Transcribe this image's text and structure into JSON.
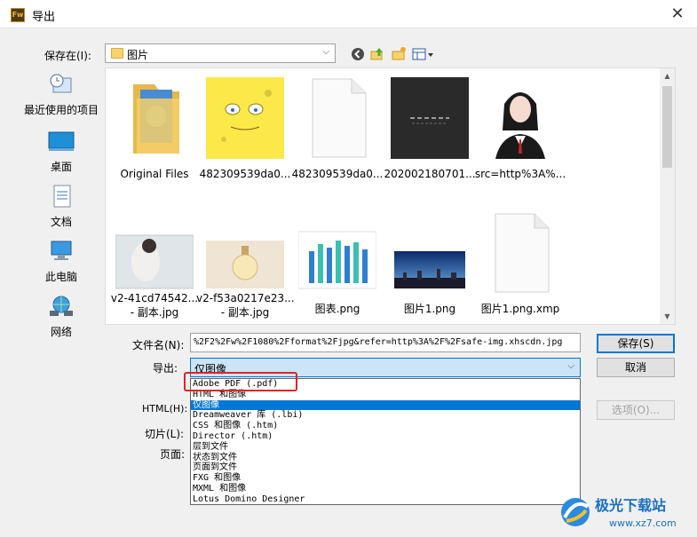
{
  "window": {
    "title": "导出",
    "app_icon": "Fw",
    "close": "✕"
  },
  "save_in": {
    "label": "保存在(I):",
    "value": "图片"
  },
  "places": [
    {
      "label": "最近使用的项目",
      "icon": "recent-icon"
    },
    {
      "label": "桌面",
      "icon": "desktop-icon"
    },
    {
      "label": "文档",
      "icon": "documents-icon"
    },
    {
      "label": "此电脑",
      "icon": "computer-icon"
    },
    {
      "label": "网络",
      "icon": "network-icon"
    }
  ],
  "files": [
    {
      "name": "Original Files",
      "kind": "folder"
    },
    {
      "name": "482309539da0...",
      "kind": "sponge"
    },
    {
      "name": "482309539da0...",
      "kind": "blank"
    },
    {
      "name": "202002180701...",
      "kind": "dark"
    },
    {
      "name": "src=http%3A%...",
      "kind": "portrait"
    },
    {
      "name": "v2-41cd74542...",
      "name2": "- 副本.jpg",
      "kind": "photo-woman"
    },
    {
      "name": "v2-f53a0217e23...",
      "name2": "- 副本.jpg",
      "kind": "photo-bottle"
    },
    {
      "name": "图表.png",
      "kind": "chart"
    },
    {
      "name": "图片1.png",
      "kind": "city"
    },
    {
      "name": "图片1.png.xmp",
      "kind": "blank"
    }
  ],
  "filename": {
    "label": "文件名(N):",
    "value": "%2F2%2Fw%2F1080%2Fformat%2Fjpg&refer=http%3A%2F%2Fsafe-img.xhscdn.jpg"
  },
  "export": {
    "label": "导出:",
    "value": "仅图像"
  },
  "html": {
    "label": "HTML(H):"
  },
  "slices": {
    "label": "切片(L):"
  },
  "pages": {
    "label": "页面:"
  },
  "buttons": {
    "save": "保存(S)",
    "cancel": "取消",
    "options": "选项(O)..."
  },
  "export_options": [
    "Adobe PDF (.pdf)",
    "HTML 和图像",
    "仅图像",
    "Dreamweaver 库 (.lbi)",
    "CSS 和图像 (.htm)",
    "Director (.htm)",
    "层到文件",
    "状态到文件",
    "页面到文件",
    "FXG 和图像",
    "MXML 和图像",
    "Lotus Domino Designer"
  ],
  "selected_option_index": 2,
  "watermark": {
    "text": "极光下载站",
    "url": "www.xz7.com"
  },
  "colors": {
    "accent": "#0078d7",
    "highlight_box": "#e02424",
    "watermark_blue": "#1a6fc4"
  }
}
